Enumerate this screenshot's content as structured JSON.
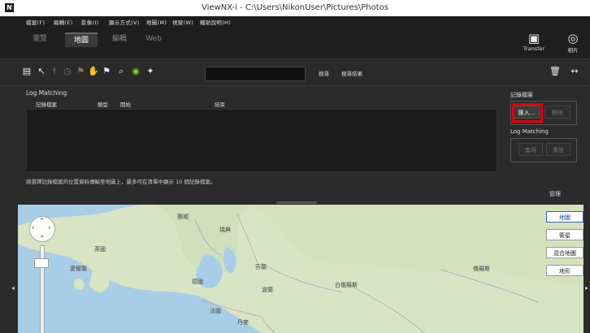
{
  "window": {
    "title": "ViewNX-i - C:\\Users\\NikonUser\\Pictures\\Photos",
    "app_icon": "N"
  },
  "menu": [
    "檔案(F)",
    "編輯(E)",
    "影像(I)",
    "顯示方式(V)",
    "地圖(M)",
    "視窗(W)",
    "輔助說明(H)"
  ],
  "tabs": [
    {
      "label": "瀏覽"
    },
    {
      "label": "地圖"
    },
    {
      "label": "編輯"
    },
    {
      "label": "Web"
    }
  ],
  "top_right": {
    "transfer_label": "Transfer",
    "photo_label": "相片"
  },
  "toolbar": {
    "search_placeholder": "",
    "search_button": "搜尋",
    "results_label": "搜尋結果"
  },
  "log_matching": {
    "header": "Log Matching",
    "columns": [
      "記錄檔案",
      "類型",
      "開始",
      "結束"
    ],
    "note": "將選擇記錄檔案的位置資料傳輸至地圖上，最多可在清單中顯示 10 個記錄檔案。"
  },
  "right_panel": {
    "log_file_label": "記錄檔案",
    "import_button": "匯入...",
    "remove_button": "移除",
    "log_matching_label": "Log Matching",
    "match_button": "套用",
    "reset_button": "重設",
    "settings_button": "管理"
  },
  "map": {
    "types": [
      {
        "label": "地圖",
        "active": true
      },
      {
        "label": "衛星",
        "active": false
      },
      {
        "label": "混合地圖",
        "active": false
      },
      {
        "label": "地形",
        "active": false
      }
    ],
    "labels": [
      "挪威",
      "瑞典",
      "芬蘭",
      "俄羅斯",
      "英國",
      "愛爾蘭",
      "德國",
      "波蘭",
      "白俄羅斯",
      "法國",
      "丹麥"
    ]
  },
  "colors": {
    "accent_highlight": "#e0000e",
    "map_water": "#a8cde6",
    "map_land": "#d8e4c4"
  }
}
